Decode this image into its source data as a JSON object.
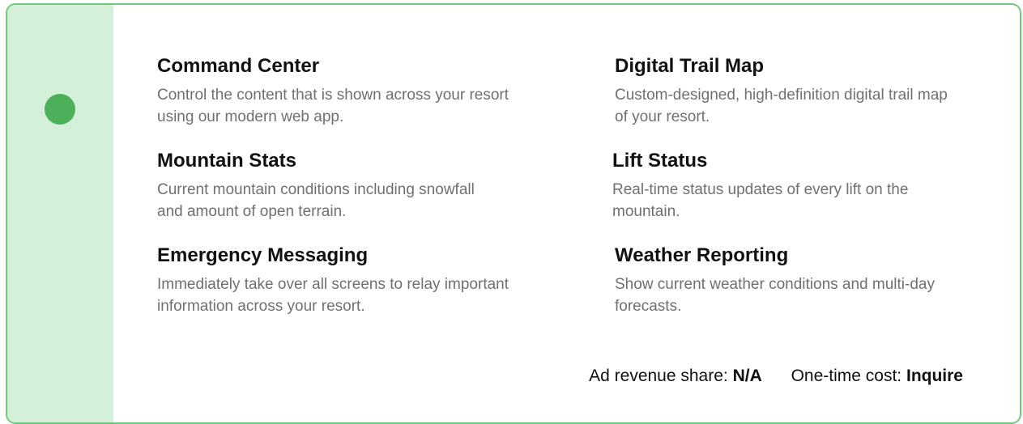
{
  "features": [
    {
      "title": "Command Center",
      "description": "Control the content that is shown across your resort using our modern web app."
    },
    {
      "title": "Digital Trail Map",
      "description": "Custom-designed, high-definition digital trail map of your resort."
    },
    {
      "title": "Mountain Stats",
      "description": "Current mountain conditions including snowfall and amount of open terrain."
    },
    {
      "title": "Lift Status",
      "description": "Real-time status updates of every lift on the mountain."
    },
    {
      "title": "Emergency Messaging",
      "description": "Immediately take over all screens to relay important information across your resort."
    },
    {
      "title": "Weather Reporting",
      "description": "Show current weather conditions and multi-day forecasts."
    }
  ],
  "pricing": {
    "ad_revenue_label": "Ad revenue share:",
    "ad_revenue_value": "N/A",
    "one_time_label": "One-time cost:",
    "one_time_value": "Inquire"
  },
  "colors": {
    "border": "#72c97b",
    "side_panel": "#d4f0d8",
    "select_dot": "#4caf5a"
  }
}
